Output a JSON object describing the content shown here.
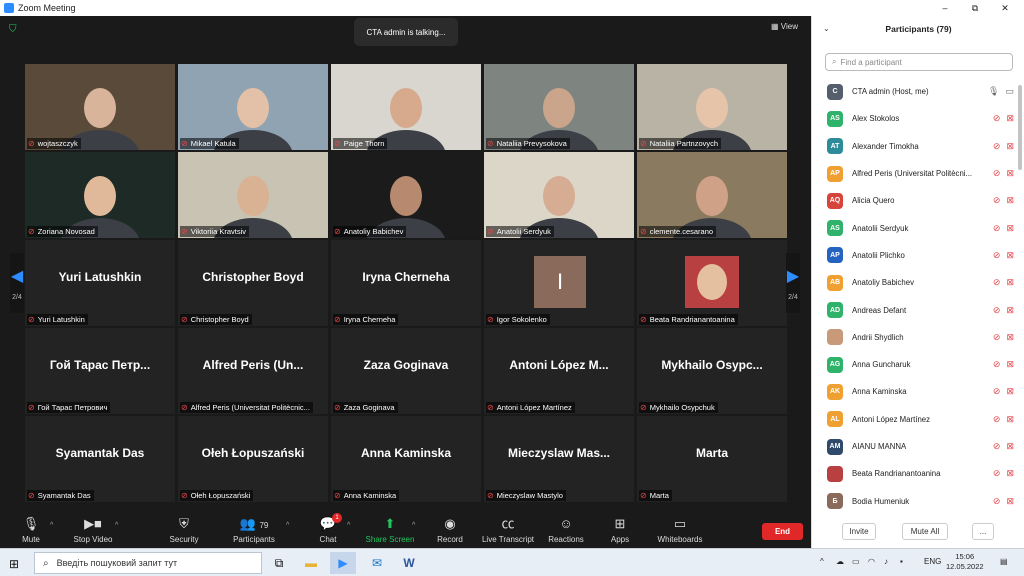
{
  "window": {
    "title": "Zoom Meeting",
    "min": "–",
    "max": "⧉",
    "close": "✕"
  },
  "meeting": {
    "talking": "CTA admin is talking...",
    "view": "View",
    "page_left": "2/4",
    "page_right": "2/4",
    "tiles": [
      {
        "name": "wojtaszczyk",
        "type": "video",
        "bg": "#5a4a3a",
        "skin": "#d8b49a"
      },
      {
        "name": "Mikael Katula",
        "type": "video",
        "bg": "#8fa3b3",
        "skin": "#e3c0a8"
      },
      {
        "name": "Paige Thorn",
        "type": "video",
        "bg": "#d9d5cf",
        "skin": "#d7a98d"
      },
      {
        "name": "Nataliia Prevysokova",
        "type": "video",
        "bg": "#7e8580",
        "skin": "#caa58c"
      },
      {
        "name": "Nataliia Partnzovych",
        "type": "video",
        "bg": "#b8b3a4",
        "skin": "#e6c4a9"
      },
      {
        "name": "Zoriana Novosad",
        "type": "video",
        "bg": "#1e2a25",
        "skin": "#e0b89a"
      },
      {
        "name": "Viktoriia Kravtsiv",
        "type": "video",
        "bg": "#c9c3b3",
        "skin": "#d9b193"
      },
      {
        "name": "Anatoliy Babichev",
        "type": "video",
        "bg": "#1b1b1b",
        "skin": "#b78a70"
      },
      {
        "name": "Anatolii Serdyuk",
        "type": "video",
        "bg": "#dcd6c8",
        "skin": "#d6ad92"
      },
      {
        "name": "clemente.cesarano",
        "type": "video",
        "bg": "#8a7a5f",
        "skin": "#cfa287"
      },
      {
        "name": "Yuri Latushkin",
        "type": "name",
        "big": "Yuri Latushkin"
      },
      {
        "name": "Christopher Boyd",
        "type": "name",
        "big": "Christopher Boyd"
      },
      {
        "name": "Iryna Cherneha",
        "type": "name",
        "big": "Iryna Cherneha"
      },
      {
        "name": "Igor Sokolenko",
        "type": "avatar",
        "letter": "I",
        "color": "#8a6a5a"
      },
      {
        "name": "Beata Randrianantoanina",
        "type": "photo",
        "bg": "#b84040",
        "skin": "#e5c0a0"
      },
      {
        "name": "Гой Тарас Петрович",
        "type": "name",
        "big": "Гой Тарас Петр..."
      },
      {
        "name": "Alfred Peris (Universitat Politècnic...",
        "type": "name",
        "big": "Alfred Peris (Un..."
      },
      {
        "name": "Zaza Goginava",
        "type": "name",
        "big": "Zaza Goginava"
      },
      {
        "name": "Antoni López Martínez",
        "type": "name",
        "big": "Antoni López M..."
      },
      {
        "name": "Mykhailo Osypchuk",
        "type": "name",
        "big": "Mykhailo  Osypc..."
      },
      {
        "name": "Syamantak Das",
        "type": "name",
        "big": "Syamantak Das"
      },
      {
        "name": "Ołeh Łopuszański",
        "type": "name",
        "big": "Ołeh Łopuszański"
      },
      {
        "name": "Anna Kaminska",
        "type": "name",
        "big": "Anna Kaminska"
      },
      {
        "name": "Mieczyslaw Mastylo",
        "type": "name",
        "big": "Mieczyslaw  Mas..."
      },
      {
        "name": "Marta",
        "type": "name",
        "big": "Marta"
      }
    ]
  },
  "toolbar": {
    "mute": "Mute",
    "stop_video": "Stop Video",
    "security": "Security",
    "participants": "Participants",
    "participants_count": "79",
    "chat": "Chat",
    "chat_badge": "1",
    "share_screen": "Share Screen",
    "record": "Record",
    "live_transcript": "Live Transcript",
    "reactions": "Reactions",
    "apps": "Apps",
    "whiteboards": "Whiteboards",
    "end": "End"
  },
  "panel": {
    "title": "Participants (79)",
    "search_placeholder": "Find a participant",
    "participants": [
      {
        "initials": "C",
        "name": "CTA admin (Host, me)",
        "color": "#555f6b",
        "mic": "on"
      },
      {
        "initials": "AS",
        "name": "Alex Stokolos",
        "color": "#2fb36b"
      },
      {
        "initials": "AT",
        "name": "Alexander Timokha",
        "color": "#2e8b9a"
      },
      {
        "initials": "AP",
        "name": "Alfred Peris (Universitat Politècni...",
        "color": "#f0a030"
      },
      {
        "initials": "AQ",
        "name": "Alicia Quero",
        "color": "#d6453b"
      },
      {
        "initials": "AS",
        "name": "Anatolii Serdyuk",
        "color": "#2fb36b"
      },
      {
        "initials": "AP",
        "name": "Anatolii Plichko",
        "color": "#2563c0"
      },
      {
        "initials": "AB",
        "name": "Anatoliy Babichev",
        "color": "#f0a030"
      },
      {
        "initials": "AD",
        "name": "Andreas Defant",
        "color": "#2fb36b"
      },
      {
        "initials": "",
        "name": "Andrii Shydlich",
        "color": "#c99a7a"
      },
      {
        "initials": "AG",
        "name": "Anna Guncharuk",
        "color": "#2fb36b"
      },
      {
        "initials": "AK",
        "name": "Anna Kaminska",
        "color": "#f0a030"
      },
      {
        "initials": "AL",
        "name": "Antoni López Martínez",
        "color": "#f0a030"
      },
      {
        "initials": "AM",
        "name": "AIANU MANNA",
        "color": "#2f4a6b"
      },
      {
        "initials": "",
        "name": "Beata Randrianantoanina",
        "color": "#b84040"
      },
      {
        "initials": "Б",
        "name": "Bodia Humeniuk",
        "color": "#8a6a5a"
      }
    ],
    "invite": "Invite",
    "mute_all": "Mute All",
    "more": "..."
  },
  "taskbar": {
    "search_placeholder": "Введіть пошуковий запит тут",
    "lang": "ENG",
    "time": "15:06",
    "date": "12.05.2022"
  }
}
